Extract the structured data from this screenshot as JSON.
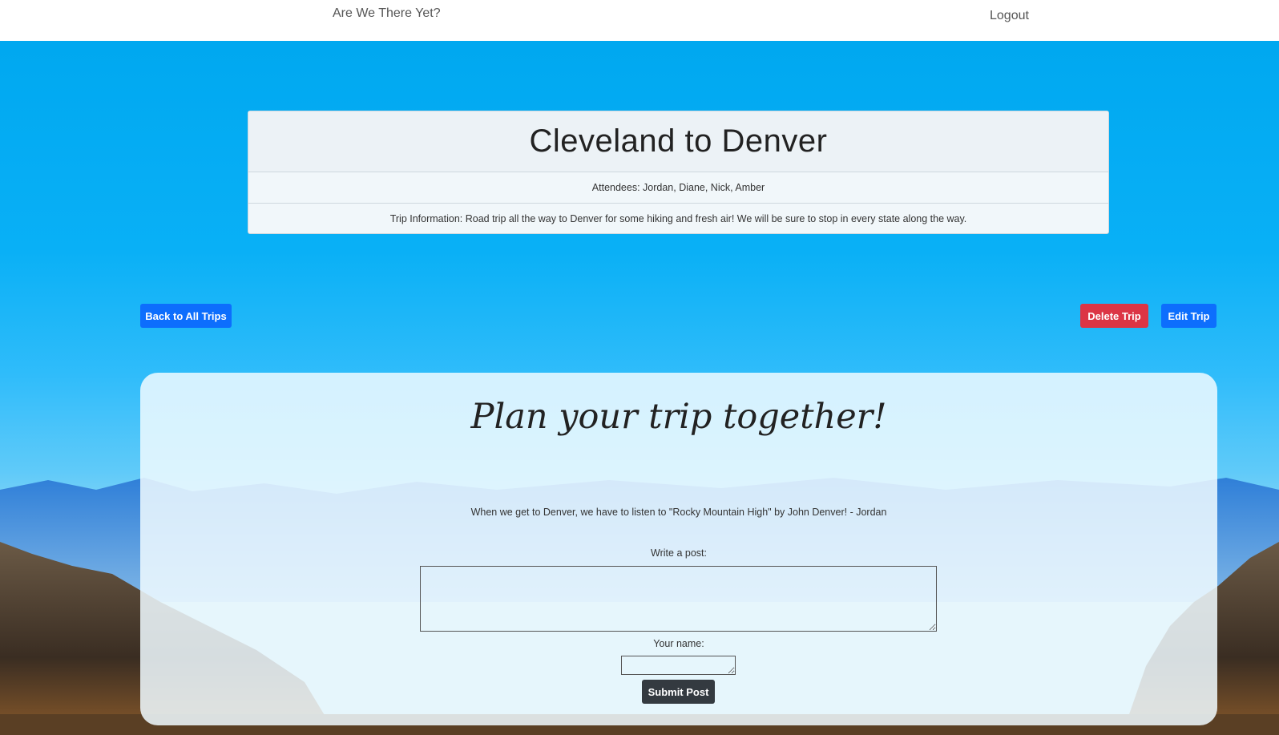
{
  "nav": {
    "brand": "Are We There Yet?",
    "logout": "Logout"
  },
  "trip": {
    "title": "Cleveland to Denver",
    "attendees": "Attendees: Jordan, Diane, Nick, Amber",
    "info": "Trip Information: Road trip all the way to Denver for some hiking and fresh air! We will be sure to stop in every state along the way."
  },
  "actions": {
    "back": "Back to All Trips",
    "delete": "Delete Trip",
    "edit": "Edit Trip"
  },
  "planner": {
    "heading": "Plan your trip together!",
    "posts": [
      "When we get to Denver, we have to listen to \"Rocky Mountain High\" by John Denver! - Jordan"
    ],
    "post_label": "Write a post:",
    "post_value": "",
    "name_label": "Your name:",
    "name_value": "",
    "submit": "Submit Post"
  },
  "colors": {
    "primary": "#0d6efd",
    "danger": "#dc3545",
    "dark": "#343a40"
  }
}
